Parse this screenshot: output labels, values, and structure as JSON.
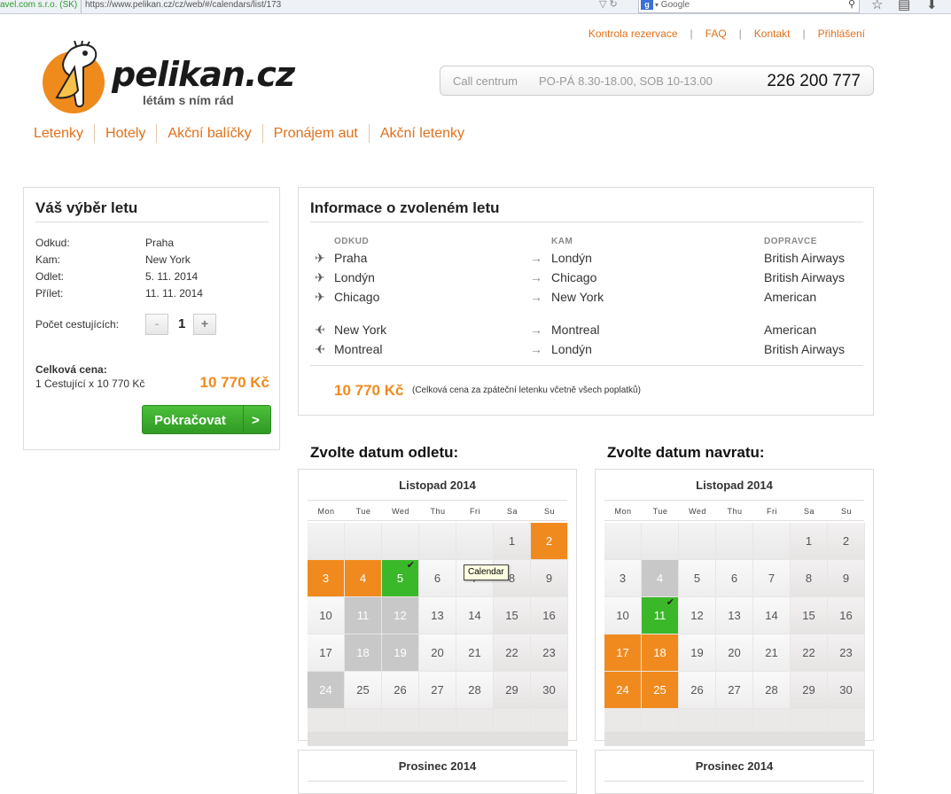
{
  "browser": {
    "cert_text": "avel.com s.r.o. (SK)",
    "url": "https://www.pelikan.cz/cz/web/#/calendars/list/173",
    "search_placeholder": "Google"
  },
  "toplinks": [
    "Kontrola rezervace",
    "FAQ",
    "Kontakt",
    "Přihlášení"
  ],
  "logo": {
    "brand": "pelikan.cz",
    "tagline": "létám s ním rád"
  },
  "callcentre": {
    "label": "Call centrum",
    "hours": "PO-PÁ 8.30-18.00, SOB 10-13.00",
    "phone": "226 200 777"
  },
  "nav": [
    "Letenky",
    "Hotely",
    "Akční balíčky",
    "Pronájem aut",
    "Akční letenky"
  ],
  "selection": {
    "title": "Váš výběr letu",
    "rows": [
      {
        "k": "Odkud:",
        "v": "Praha"
      },
      {
        "k": "Kam:",
        "v": "New York"
      },
      {
        "k": "Odlet:",
        "v": "5. 11. 2014"
      },
      {
        "k": "Přílet:",
        "v": "11. 11. 2014"
      }
    ],
    "pax_label": "Počet cestujících:",
    "pax_minus": "-",
    "pax_value": "1",
    "pax_plus": "+",
    "total_label": "Celková cena:",
    "total_sub": "1 Cestující x 10 770 Kč",
    "total_price": "10 770 Kč",
    "continue_label": "Pokračovat",
    "continue_arrow": ">"
  },
  "info": {
    "title": "Informace o zvoleném letu",
    "col_from": "ODKUD",
    "col_to": "KAM",
    "col_carrier": "DOPRAVCE",
    "outbound": [
      {
        "from": "Praha",
        "to": "Londýn",
        "carrier": "British Airways"
      },
      {
        "from": "Londýn",
        "to": "Chicago",
        "carrier": "British Airways"
      },
      {
        "from": "Chicago",
        "to": "New York",
        "carrier": "American"
      }
    ],
    "inbound": [
      {
        "from": "New York",
        "to": "Montreal",
        "carrier": "American"
      },
      {
        "from": "Montreal",
        "to": "Londýn",
        "carrier": "British Airways"
      }
    ],
    "price": "10 770 Kč",
    "note": "(Celková cena za zpáteční letenku včetně všech poplatků)"
  },
  "departure": {
    "heading": "Zvolte datum odletu:",
    "month": "Listopad 2014",
    "next_month": "Prosinec 2014",
    "selected_day": 5
  },
  "return": {
    "heading": "Zvolte datum navratu:",
    "month": "Listopad 2014",
    "next_month": "Prosinec 2014",
    "selected_day": 11
  },
  "dow": [
    "Mon",
    "Tue",
    "Wed",
    "Thu",
    "Fri",
    "Sa",
    "Su"
  ],
  "tooltip": "Calendar",
  "colors": {
    "accent": "#ef8a1c",
    "selected": "#3bb82a",
    "unavailable": "#c8c8c8"
  }
}
